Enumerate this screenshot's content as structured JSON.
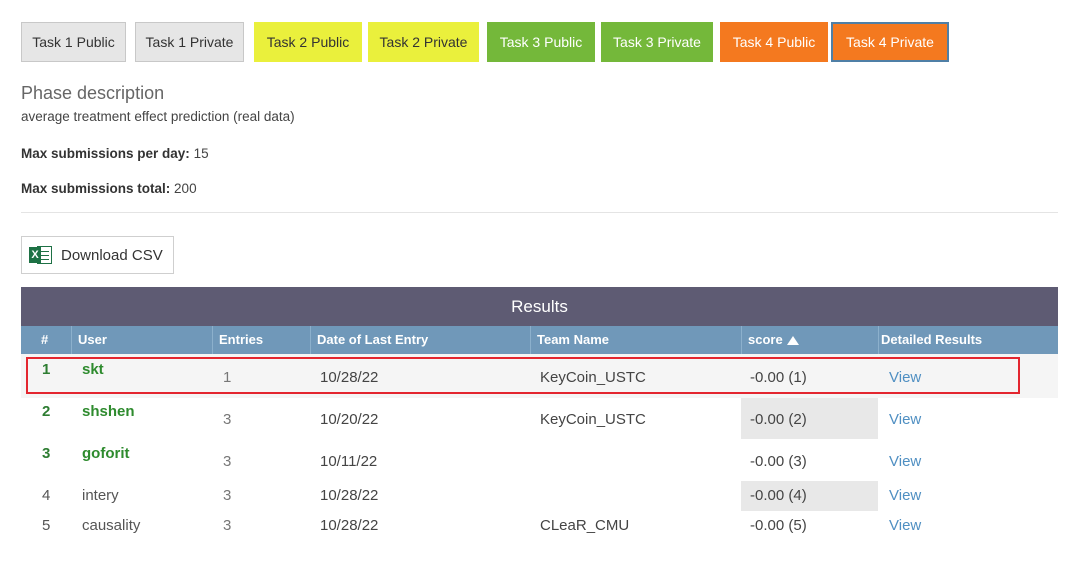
{
  "tabs": [
    {
      "label": "Task 1 Public"
    },
    {
      "label": "Task 1 Private"
    },
    {
      "label": "Task 2 Public"
    },
    {
      "label": "Task 2 Private"
    },
    {
      "label": "Task 3 Public"
    },
    {
      "label": "Task 3 Private"
    },
    {
      "label": "Task 4 Public"
    },
    {
      "label": "Task 4 Private"
    }
  ],
  "active_tab": "Task 4 Private",
  "colors": {
    "tab_gray": "#e6e6e6",
    "tab_yellow": "#eaf03c",
    "tab_green": "#74b83a",
    "tab_orange": "#f4791f",
    "results_header": "#5e5b73",
    "column_header": "#7098b9",
    "highlight": "#e3262f",
    "user_green": "#2e8b2e",
    "link_blue": "#4f8fc2"
  },
  "phase": {
    "title": "Phase description",
    "description": "average treatment effect prediction (real data)",
    "max_per_day_label": "Max submissions per day:",
    "max_per_day_value": "15",
    "max_total_label": "Max submissions total:",
    "max_total_value": "200"
  },
  "download": {
    "icon": "excel-icon",
    "icon_letter": "X",
    "label": "Download CSV"
  },
  "results": {
    "title": "Results",
    "columns": [
      "#",
      "User",
      "Entries",
      "Date of Last Entry",
      "Team Name",
      "score",
      "Detailed Results"
    ],
    "sort_column": "score",
    "sort_direction": "ascending",
    "rows": [
      {
        "rank": "1",
        "user": "skt",
        "entries": "1",
        "date": "10/28/22",
        "team": "KeyCoin_USTC",
        "score": "-0.00 (1)",
        "details": "View",
        "highlighted": true
      },
      {
        "rank": "2",
        "user": "shshen",
        "entries": "3",
        "date": "10/20/22",
        "team": "KeyCoin_USTC",
        "score": "-0.00 (2)",
        "details": "View"
      },
      {
        "rank": "3",
        "user": "goforit",
        "entries": "3",
        "date": "10/11/22",
        "team": "",
        "score": "-0.00 (3)",
        "details": "View"
      },
      {
        "rank": "4",
        "user": "intery",
        "entries": "3",
        "date": "10/28/22",
        "team": "",
        "score": "-0.00 (4)",
        "details": "View"
      },
      {
        "rank": "5",
        "user": "causality",
        "entries": "3",
        "date": "10/28/22",
        "team": "CLeaR_CMU",
        "score": "-0.00 (5)",
        "details": "View"
      }
    ]
  }
}
